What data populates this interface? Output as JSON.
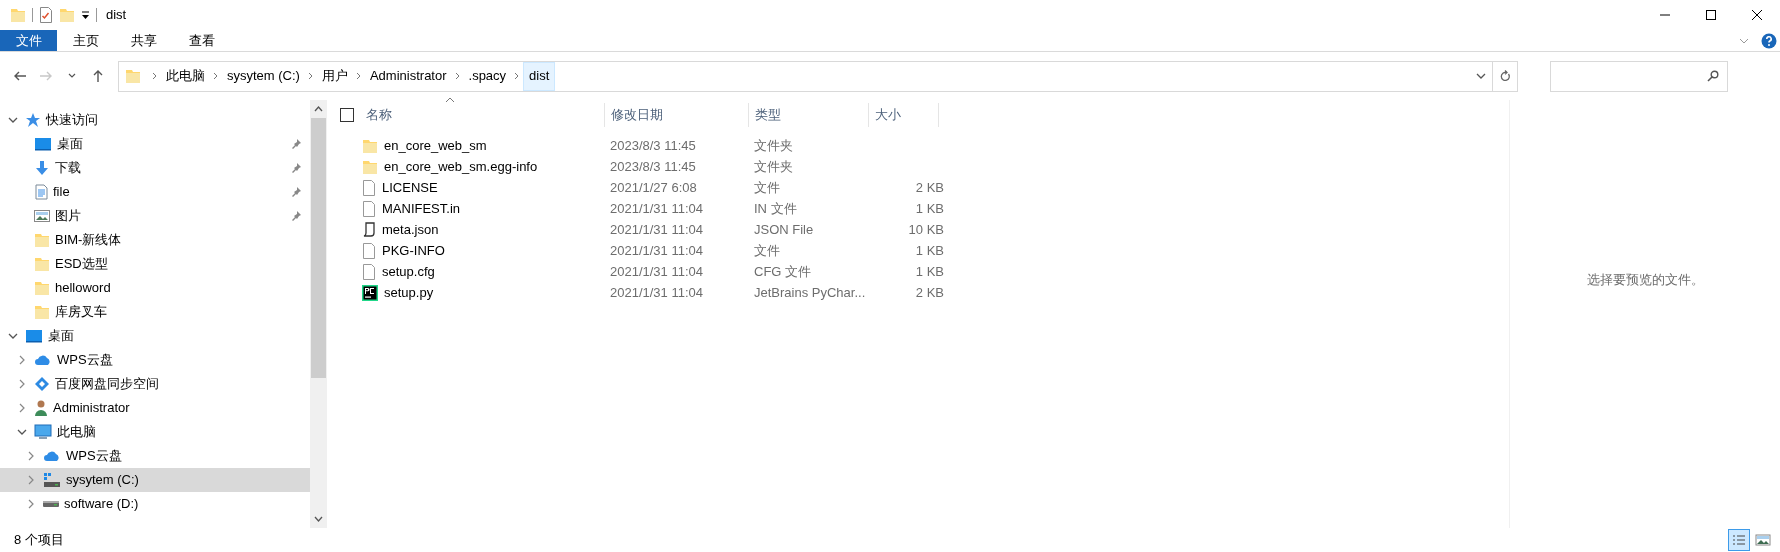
{
  "window": {
    "title": "dist"
  },
  "ribbon": {
    "tabs": [
      {
        "label": "文件",
        "kind": "file"
      },
      {
        "label": "主页",
        "kind": "tab"
      },
      {
        "label": "共享",
        "kind": "tab"
      },
      {
        "label": "查看",
        "kind": "tab"
      }
    ]
  },
  "navigation": [
    {
      "kind": "back",
      "disabled": false
    },
    {
      "kind": "forward",
      "disabled": true
    },
    {
      "kind": "recent",
      "disabled": false
    },
    {
      "kind": "up",
      "disabled": false
    }
  ],
  "address_bar": {
    "segments": [
      {
        "label": "此电脑",
        "selected": false
      },
      {
        "label": "sysytem (C:)",
        "selected": false
      },
      {
        "label": "用户",
        "selected": false
      },
      {
        "label": "Administrator",
        "selected": false
      },
      {
        "label": ".spacy",
        "selected": false
      },
      {
        "label": "dist",
        "selected": true
      }
    ]
  },
  "sidebar": {
    "tree": [
      {
        "label": "快速访问",
        "kind": "star",
        "expanded": true,
        "selected": false,
        "children": [
          {
            "label": "桌面",
            "kind": "desktop",
            "pinned": true,
            "selected": false
          },
          {
            "label": "下载",
            "kind": "download",
            "pinned": true,
            "selected": false
          },
          {
            "label": "file",
            "kind": "document",
            "pinned": true,
            "selected": false
          },
          {
            "label": "图片",
            "kind": "pictures",
            "pinned": true,
            "selected": false
          },
          {
            "label": "BIM-新线体",
            "kind": "folder",
            "pinned": false,
            "selected": false
          },
          {
            "label": "ESD选型",
            "kind": "folder",
            "pinned": false,
            "selected": false
          },
          {
            "label": "helloword",
            "kind": "folder",
            "pinned": false,
            "selected": false
          },
          {
            "label": "库房叉车",
            "kind": "folder",
            "pinned": false,
            "selected": false
          }
        ]
      },
      {
        "label": "桌面",
        "kind": "desktop",
        "expanded": true,
        "selected": false,
        "children": [
          {
            "label": "WPS云盘",
            "kind": "cloud",
            "expanded": false,
            "selected": false
          },
          {
            "label": "百度网盘同步空间",
            "kind": "sync",
            "expanded": false,
            "selected": false
          },
          {
            "label": "Administrator",
            "kind": "user",
            "expanded": false,
            "selected": false
          },
          {
            "label": "此电脑",
            "kind": "computer",
            "expanded": true,
            "selected": false,
            "children": [
              {
                "label": "WPS云盘",
                "kind": "cloud",
                "expanded": false,
                "selected": false
              },
              {
                "label": "sysytem (C:)",
                "kind": "system-drive",
                "expanded": false,
                "selected": true
              },
              {
                "label": "software (D:)",
                "kind": "drive",
                "expanded": false,
                "selected": false
              }
            ]
          }
        ]
      }
    ]
  },
  "file_list": {
    "select_all_checked": false,
    "columns": [
      {
        "label": "名称",
        "sorted": true
      },
      {
        "label": "修改日期",
        "sorted": false
      },
      {
        "label": "类型",
        "sorted": false
      },
      {
        "label": "大小",
        "sorted": false
      }
    ],
    "rows": [
      {
        "name": "en_core_web_sm",
        "date": "2023/8/3 11:45",
        "type": "文件夹",
        "kind": "folder"
      },
      {
        "name": "en_core_web_sm.egg-info",
        "date": "2023/8/3 11:45",
        "type": "文件夹",
        "kind": "folder"
      },
      {
        "name": "LICENSE",
        "date": "2021/1/27 6:08",
        "type": "文件",
        "size": "2 KB",
        "kind": "file"
      },
      {
        "name": "MANIFEST.in",
        "date": "2021/1/31 11:04",
        "type": "IN 文件",
        "size": "1 KB",
        "kind": "file"
      },
      {
        "name": "meta.json",
        "date": "2021/1/31 11:04",
        "type": "JSON File",
        "size": "10 KB",
        "kind": "json"
      },
      {
        "name": "PKG-INFO",
        "date": "2021/1/31 11:04",
        "type": "文件",
        "size": "1 KB",
        "kind": "file"
      },
      {
        "name": "setup.cfg",
        "date": "2021/1/31 11:04",
        "type": "CFG 文件",
        "size": "1 KB",
        "kind": "file"
      },
      {
        "name": "setup.py",
        "date": "2021/1/31 11:04",
        "type": "JetBrains PyChar...",
        "size": "2 KB",
        "kind": "pycharm"
      }
    ]
  },
  "preview_pane": {
    "message": "选择要预览的文件。"
  },
  "status_bar": {
    "item_count": "8 个项目",
    "views": [
      {
        "kind": "details",
        "selected": true
      },
      {
        "kind": "large-icons",
        "selected": false
      }
    ]
  }
}
